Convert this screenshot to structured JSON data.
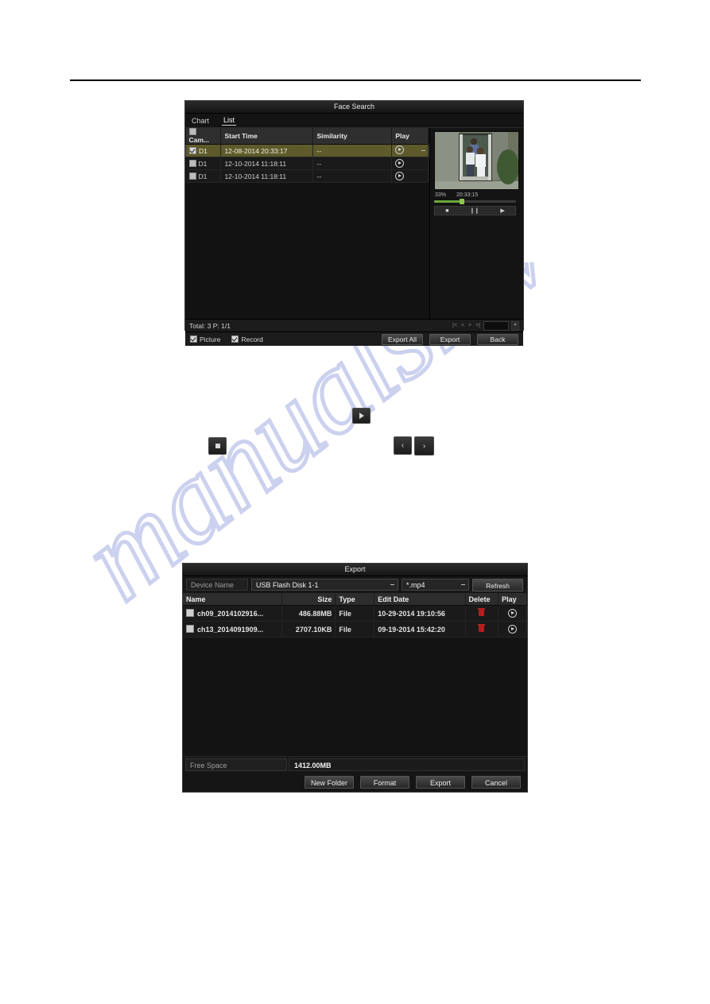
{
  "watermark": {
    "text": "manualshive.com"
  },
  "face_search": {
    "title": "Face Search",
    "tabs": [
      {
        "label": "Chart",
        "active": false
      },
      {
        "label": "List",
        "active": true
      }
    ],
    "columns": [
      "Cam...",
      "Start Time",
      "Similarity",
      "Play"
    ],
    "rows": [
      {
        "cam": "D1",
        "start_time": "12-08-2014 20:33:17",
        "similarity": "--",
        "checked": true
      },
      {
        "cam": "D1",
        "start_time": "12-10-2014 11:18:11",
        "similarity": "--",
        "checked": false
      },
      {
        "cam": "D1",
        "start_time": "12-10-2014 11:18:11",
        "similarity": "--",
        "checked": false
      }
    ],
    "total_text": "Total: 3  P: 1/1",
    "pager": {
      "first": "|<",
      "prev": "<",
      "next": ">",
      "last": ">|",
      "page_value": ""
    },
    "options": [
      {
        "label": "Picture",
        "checked": true
      },
      {
        "label": "Record",
        "checked": true
      }
    ],
    "buttons": [
      {
        "label": "Export All"
      },
      {
        "label": "Export"
      },
      {
        "label": "Back"
      }
    ],
    "preview": {
      "progress": "33%",
      "time": "20:33:15",
      "progress_percent": 33,
      "controls": [
        "stop",
        "pause",
        "next"
      ]
    }
  },
  "floating_buttons": [
    {
      "name": "play",
      "glyph": "play"
    },
    {
      "name": "stop",
      "glyph": "stop"
    },
    {
      "name": "prev",
      "glyph": "‹"
    },
    {
      "name": "next",
      "glyph": "›"
    }
  ],
  "export": {
    "title": "Export",
    "device_label": "Device Name",
    "device_value": "USB Flash Disk 1-1",
    "filetype_value": "*.mp4",
    "refresh_label": "Refresh",
    "columns": [
      "Name",
      "Size",
      "Type",
      "Edit Date",
      "Delete",
      "Play"
    ],
    "rows": [
      {
        "name": "ch09_2014102916...",
        "size": "486.88MB",
        "type": "File",
        "edit_date": "10-29-2014 19:10:56"
      },
      {
        "name": "ch13_2014091909...",
        "size": "2707.10KB",
        "type": "File",
        "edit_date": "09-19-2014 15:42:20"
      }
    ],
    "free_space_label": "Free Space",
    "free_space_value": "1412.00MB",
    "buttons": [
      {
        "label": "New Folder"
      },
      {
        "label": "Format"
      },
      {
        "label": "Export"
      },
      {
        "label": "Cancel"
      }
    ]
  },
  "colors": {
    "accent_selected_row": "#5e5a2b",
    "progress_green": "#6aa83a",
    "delete_red": "#b3201e",
    "watermark": "#bfc6ea"
  }
}
